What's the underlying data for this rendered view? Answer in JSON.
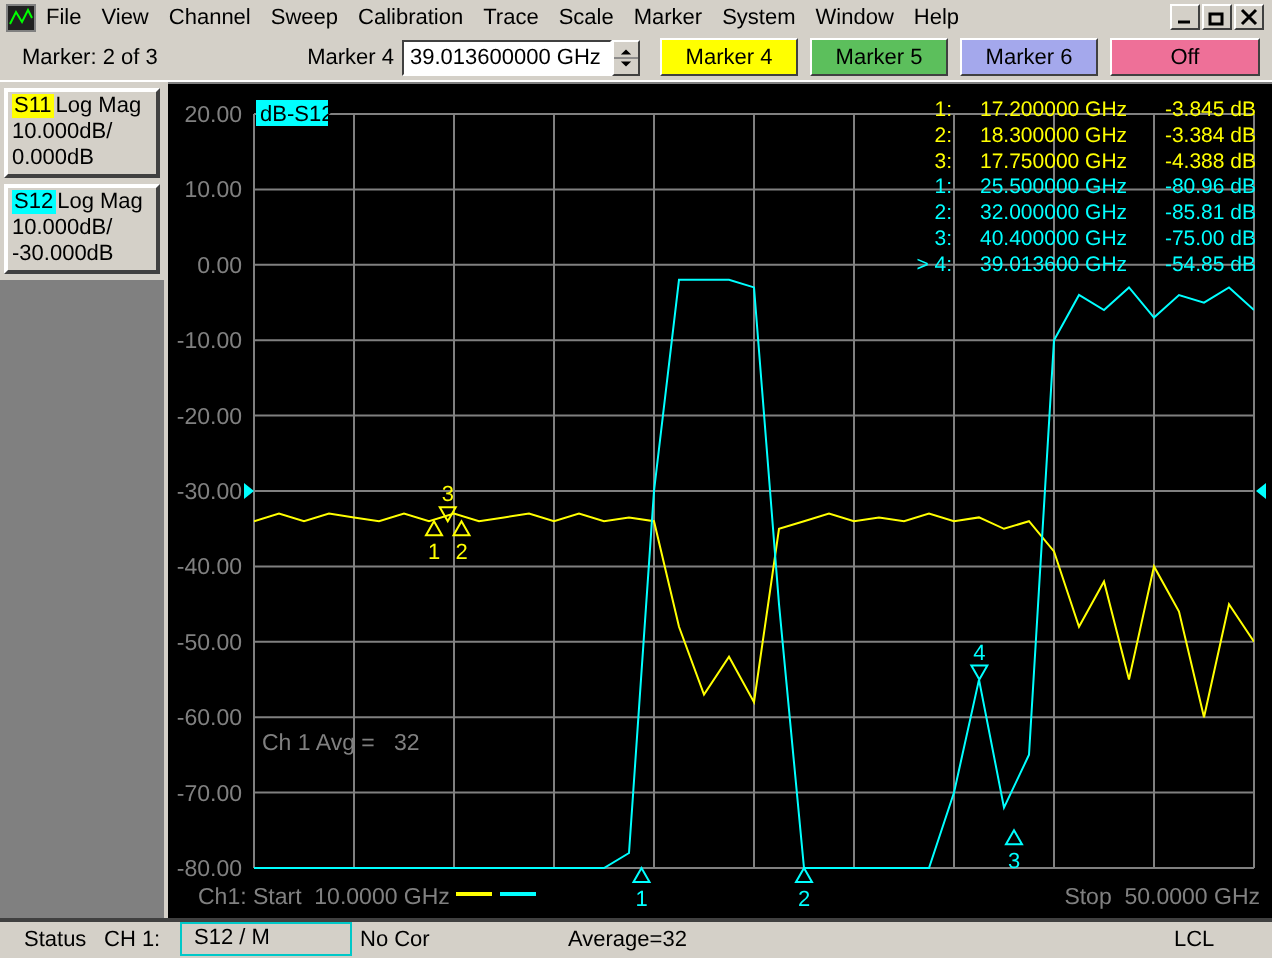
{
  "menu": [
    "File",
    "View",
    "Channel",
    "Sweep",
    "Calibration",
    "Trace",
    "Scale",
    "Marker",
    "System",
    "Window",
    "Help"
  ],
  "toolbar": {
    "marker_count": "Marker: 2 of 3",
    "marker_field_label": "Marker 4",
    "marker_field_value": "39.013600000 GHz",
    "marker_buttons": [
      {
        "label": "Marker 4",
        "color": "#ffff00"
      },
      {
        "label": "Marker 5",
        "color": "#5cbf5c"
      },
      {
        "label": "Marker 6",
        "color": "#a4a8ec"
      },
      {
        "label": "Off",
        "color": "#ee7098"
      }
    ]
  },
  "traces": [
    {
      "name": "S11",
      "format": "Log Mag",
      "scale": "10.000dB/",
      "reference": "0.000dB",
      "color": "#ffff00"
    },
    {
      "name": "S12",
      "format": "Log Mag",
      "scale": "10.000dB/",
      "reference": "-30.000dB",
      "color": "#00ffff"
    }
  ],
  "plot": {
    "trace_label": "dB-S12",
    "y_labels": [
      "20.00",
      "10.00",
      "0.00",
      "-10.00",
      "-20.00",
      "-30.00",
      "-40.00",
      "-50.00",
      "-60.00",
      "-70.00",
      "-80.00"
    ],
    "avg_text": "Ch 1 Avg =   32",
    "start_text": "Ch1: Start  10.0000 GHz",
    "stop_text": "Stop  50.0000 GHz",
    "markers": [
      {
        "label": "1",
        "color": "#ffff00"
      },
      {
        "label": "2",
        "color": "#ffff00"
      },
      {
        "label": "3",
        "color": "#ffff00"
      },
      {
        "label": "1",
        "color": "#00ffff"
      },
      {
        "label": "2",
        "color": "#00ffff"
      },
      {
        "label": "3",
        "color": "#00ffff"
      },
      {
        "label": "4",
        "color": "#00ffff"
      }
    ],
    "marker_table": [
      {
        "number": "1:",
        "frequency": "17.200000 GHz",
        "value": "-3.845 dB",
        "color": "#ffff00"
      },
      {
        "number": "2:",
        "frequency": "18.300000 GHz",
        "value": "-3.384 dB",
        "color": "#ffff00"
      },
      {
        "number": "3:",
        "frequency": "17.750000 GHz",
        "value": "-4.388 dB",
        "color": "#ffff00"
      },
      {
        "number": "1:",
        "frequency": "25.500000 GHz",
        "value": "-80.96 dB",
        "color": "#00ffff"
      },
      {
        "number": "2:",
        "frequency": "32.000000 GHz",
        "value": "-85.81 dB",
        "color": "#00ffff"
      },
      {
        "number": "3:",
        "frequency": "40.400000 GHz",
        "value": "-75.00 dB",
        "color": "#00ffff"
      },
      {
        "number": "> 4:",
        "frequency": "39.013600 GHz",
        "value": "-54.85 dB",
        "color": "#00ffff"
      }
    ]
  },
  "status": {
    "label": "Status",
    "channel": "CH 1:",
    "measurement": "S12 / M",
    "correction": "No Cor",
    "average": "Average=32",
    "mode": "LCL"
  }
}
